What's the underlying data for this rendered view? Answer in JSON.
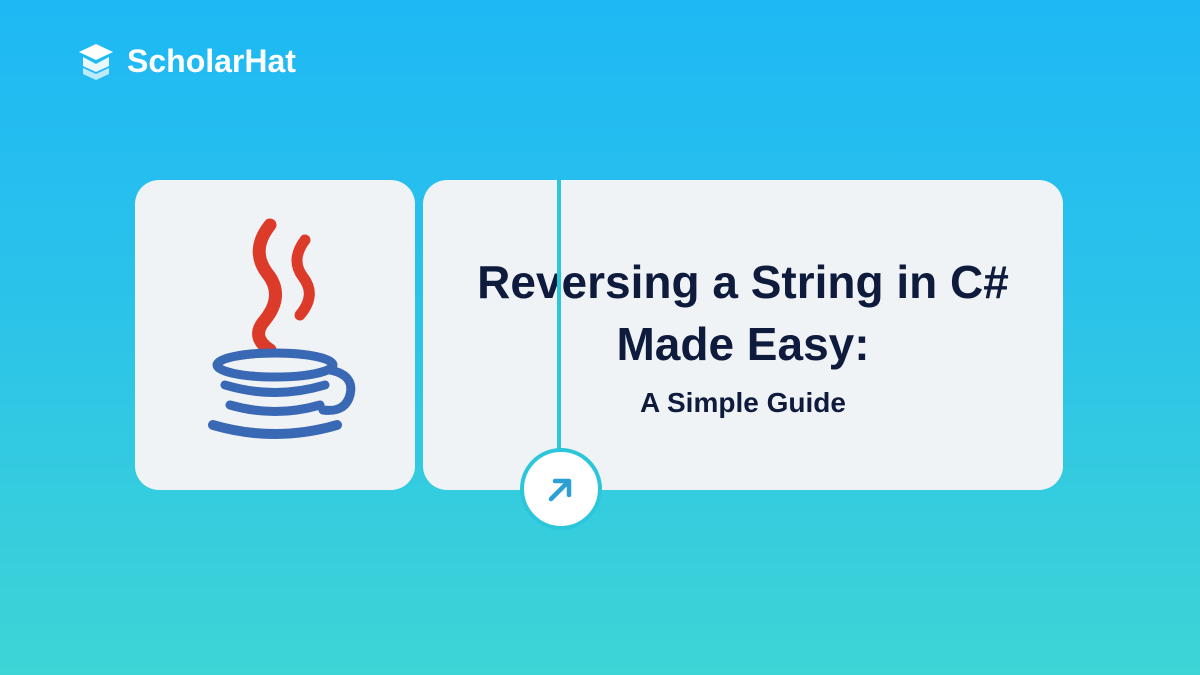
{
  "logo": {
    "text": "ScholarHat"
  },
  "card": {
    "title": "Reversing a String in C# Made Easy:",
    "subtitle": "A Simple Guide"
  }
}
